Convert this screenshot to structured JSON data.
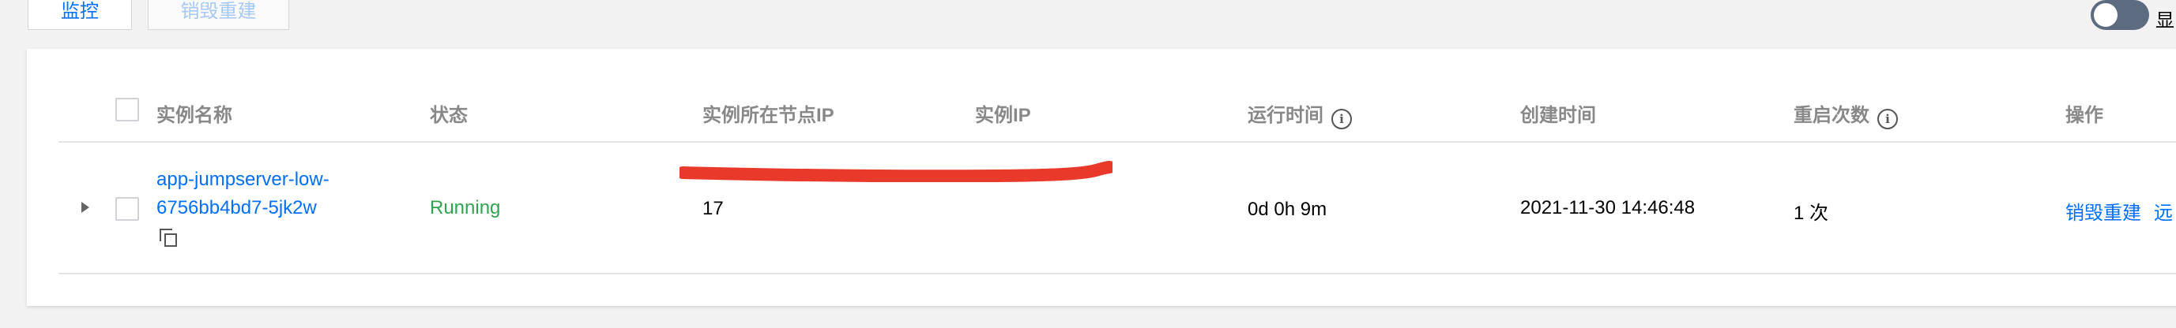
{
  "toolbar": {
    "monitor_label": "监控",
    "destroy_rebuild_label": "销毁重建",
    "toggle_label": "显"
  },
  "table": {
    "headers": {
      "instance_name": "实例名称",
      "status": "状态",
      "node_ip": "实例所在节点IP",
      "instance_ip": "实例IP",
      "uptime": "运行时间",
      "created_at": "创建时间",
      "restart_count": "重启次数",
      "actions": "操作"
    },
    "rows": [
      {
        "name_line1": "app-jumpserver-low-",
        "name_line2": "6756bb4bd7-5jk2w",
        "status": "Running",
        "node_ip": "17",
        "uptime": "0d 0h 9m",
        "created_at": "2021-11-30 14:46:48",
        "restart_count": "1 次",
        "action_destroy": "销毁重建",
        "action_remote": "远"
      }
    ]
  },
  "colors": {
    "link": "#006eff",
    "status_running": "#2fa44f",
    "redaction": "#e8392b"
  }
}
